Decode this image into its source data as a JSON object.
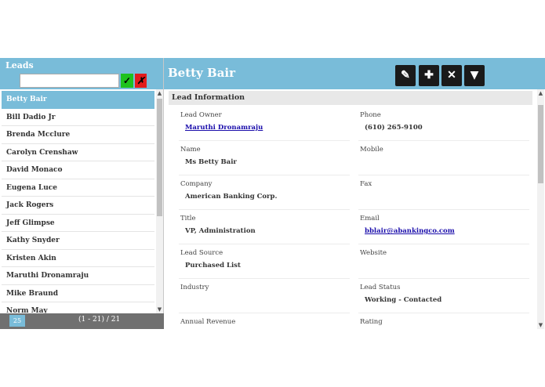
{
  "leads_panel": {
    "title": "Leads",
    "search_value": "",
    "confirm_symbol": "✓",
    "cancel_symbol": "✗",
    "items": [
      {
        "label": "Betty Bair"
      },
      {
        "label": "Bill Dadio Jr"
      },
      {
        "label": "Brenda Mcclure"
      },
      {
        "label": "Carolyn Crenshaw"
      },
      {
        "label": "David Monaco"
      },
      {
        "label": "Eugena Luce"
      },
      {
        "label": "Jack Rogers"
      },
      {
        "label": "Jeff Glimpse"
      },
      {
        "label": "Kathy Snyder"
      },
      {
        "label": "Kristen Akin"
      },
      {
        "label": "Maruthi Dronamraju"
      },
      {
        "label": "Mike Braund"
      },
      {
        "label": "Norm May"
      }
    ],
    "selected_item": "Betty Bair",
    "page_size": "25",
    "page_info": "(1 - 21) / 21"
  },
  "record": {
    "title": "Betty Bair",
    "toolbar": {
      "edit_icon": "pencil-icon",
      "edit_symbol": "✎",
      "add_icon": "plus-icon",
      "add_symbol": "✚",
      "delete_icon": "close-icon",
      "delete_symbol": "✕",
      "more_icon": "triangle-down-icon",
      "more_symbol": "▼"
    },
    "section_title": "Lead Information",
    "fields": {
      "lead_owner": {
        "label": "Lead Owner",
        "value": "Maruthi Dronamraju"
      },
      "phone": {
        "label": "Phone",
        "value": "(610) 265-9100"
      },
      "name": {
        "label": "Name",
        "value": "Ms Betty Bair"
      },
      "mobile": {
        "label": "Mobile",
        "value": ""
      },
      "company": {
        "label": "Company",
        "value": "American Banking Corp."
      },
      "fax": {
        "label": "Fax",
        "value": ""
      },
      "title": {
        "label": "Title",
        "value": "VP, Administration"
      },
      "email": {
        "label": "Email",
        "value": "bblair@abankingco.com"
      },
      "lead_source": {
        "label": "Lead Source",
        "value": "Purchased List"
      },
      "website": {
        "label": "Website",
        "value": ""
      },
      "industry": {
        "label": "Industry",
        "value": ""
      },
      "lead_status": {
        "label": "Lead Status",
        "value": "Working - Contacted"
      },
      "annual_revenue": {
        "label": "Annual Revenue",
        "value": ""
      },
      "rating": {
        "label": "Rating",
        "value": ""
      }
    }
  },
  "colors": {
    "accent": "#79bcd9",
    "toolbar_button": "#1a1a1a",
    "confirm": "#1ec21e",
    "cancel": "#e21c1c",
    "footer": "#707070"
  }
}
